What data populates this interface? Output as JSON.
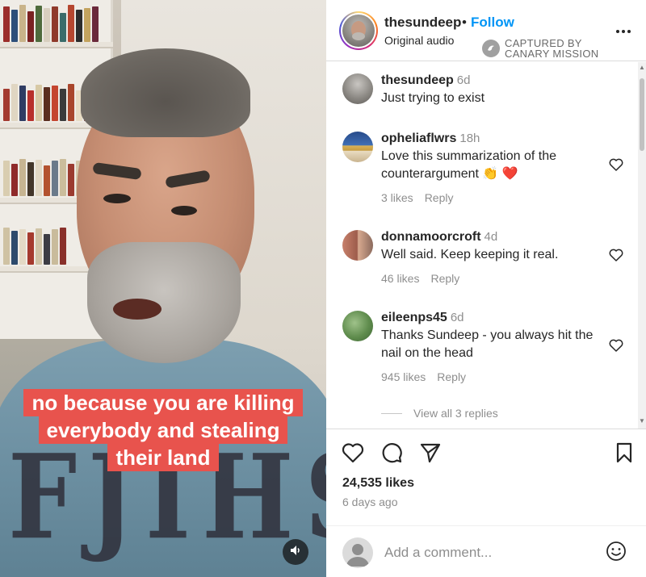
{
  "video": {
    "caption_lines": [
      "no because you are killing",
      "everybody and stealing",
      "their land"
    ],
    "shirt_print": "FJIHS",
    "mute_icon": "speaker-icon"
  },
  "header": {
    "username": "thesundeep",
    "separator": "•",
    "follow_label": "Follow",
    "audio_label": "Original audio",
    "watermark_line1": "CAPTURED BY",
    "watermark_line2": "CANARY MISSION",
    "more_icon": "more-options-icon"
  },
  "comments": [
    {
      "user": "thesundeep",
      "time": "6d",
      "text": "Just trying to exist",
      "likes": "",
      "reply": ""
    },
    {
      "user": "opheliaflwrs",
      "time": "18h",
      "text": "Love this summarization of the counterargument 👏 ❤️",
      "likes": "3 likes",
      "reply": "Reply"
    },
    {
      "user": "donnamoorcroft",
      "time": "4d",
      "text": "Well said. Keep keeping it real.",
      "likes": "46 likes",
      "reply": "Reply"
    },
    {
      "user": "eileenps45",
      "time": "6d",
      "text": "Thanks Sundeep - you always hit the nail on the head",
      "likes": "945 likes",
      "reply": "Reply"
    }
  ],
  "view_replies": "View all 3 replies",
  "actions": {
    "likes_count": "24,535 likes",
    "posted_ago": "6 days ago",
    "icons": [
      "heart-icon",
      "comment-icon",
      "share-icon",
      "bookmark-icon"
    ]
  },
  "add_comment": {
    "placeholder": "Add a comment...",
    "emoji_icon": "emoji-icon"
  },
  "colors": {
    "accent": "#0095f6",
    "caption_bg": "#e8534d",
    "muted_text": "#8e8e8e",
    "heart_red": "#ed4956"
  }
}
